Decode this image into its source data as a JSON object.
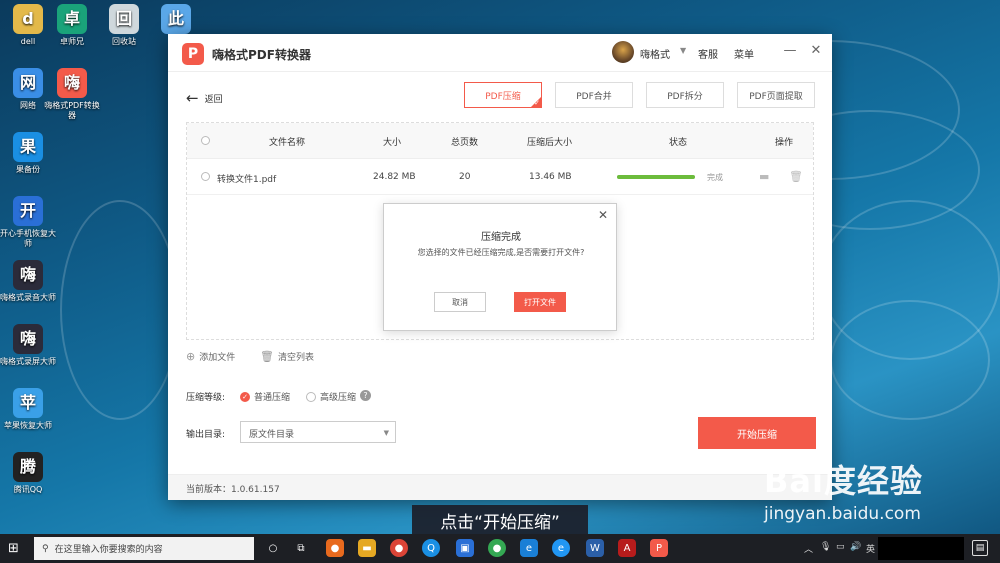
{
  "desktop": {
    "icons": [
      {
        "label": "dell",
        "icon": "folder-user-icon",
        "color": "#e3b94a"
      },
      {
        "label": "卓师兄",
        "icon": "zhuoshixiong-icon",
        "color": "#1aa37a"
      },
      {
        "label": "回收站",
        "icon": "recycle-bin-icon",
        "color": "#cfd8dc"
      },
      {
        "label": "此",
        "icon": "computer-icon",
        "color": "#5aa7e8"
      },
      {
        "label": "网络",
        "icon": "network-icon",
        "color": "#3a8ee6"
      },
      {
        "label": "嗨格式PDF转换器",
        "icon": "pdf-converter-icon",
        "color": "#f35a4a"
      },
      {
        "label": "果备份",
        "icon": "guo-backup-icon",
        "color": "#1a8fe3"
      },
      {
        "label": "开心手机恢复大师",
        "icon": "phone-recovery-icon",
        "color": "#2a6fd6"
      },
      {
        "label": "嗨格式录音大师",
        "icon": "audio-recorder-icon",
        "color": "#2b2b3a"
      },
      {
        "label": "嗨格式录屏大师",
        "icon": "screen-recorder-icon",
        "color": "#2b2b3a"
      },
      {
        "label": "苹果恢复大师",
        "icon": "apple-recovery-icon",
        "color": "#3aa0e8"
      },
      {
        "label": "腾讯QQ",
        "icon": "qq-icon",
        "color": "#222222"
      }
    ]
  },
  "window": {
    "title": "嗨格式PDF转换器",
    "user_name": "嗨格式",
    "support": "客服",
    "menu": "菜单",
    "back": "返回",
    "tabs": [
      "PDF压缩",
      "PDF合并",
      "PDF拆分",
      "PDF页面提取"
    ],
    "active_tab": 0,
    "table": {
      "headers": [
        "文件名称",
        "大小",
        "总页数",
        "压缩后大小",
        "状态",
        "操作"
      ],
      "rows": [
        {
          "name": "转换文件1.pdf",
          "size": "24.82 MB",
          "pages": "20",
          "compressed": "13.46 MB",
          "progress": 1.0,
          "status": "完成"
        }
      ]
    },
    "dialog": {
      "title": "压缩完成",
      "message": "您选择的文件已经压缩完成,是否需要打开文件?",
      "cancel": "取消",
      "open": "打开文件"
    },
    "add_file": "添加文件",
    "clear_list": "清空列表",
    "level_label": "压缩等级:",
    "levels": [
      "普通压缩",
      "高级压缩"
    ],
    "selected_level": 0,
    "output_label": "输出目录:",
    "output_value": "原文件目录",
    "start": "开始压缩",
    "version": "当前版本：1.0.61.157"
  },
  "subtitle": "点击“开始压缩”",
  "watermark": {
    "main": "Bai度经验",
    "url": "jingyan.baidu.com"
  },
  "taskbar": {
    "search_placeholder": "在这里输入你要搜索的内容",
    "ime": "英"
  },
  "colors": {
    "accent": "#f35a4a",
    "progress": "#6cbc3c"
  }
}
